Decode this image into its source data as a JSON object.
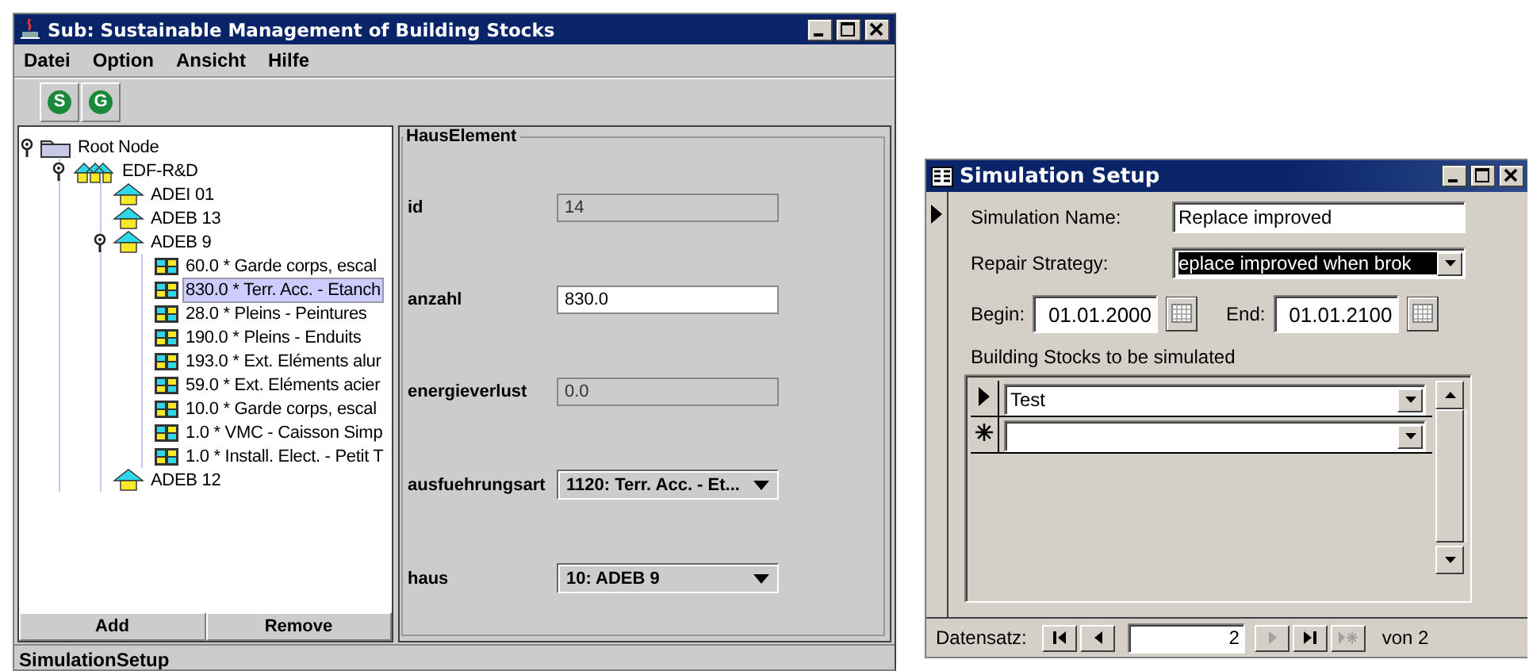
{
  "main_window": {
    "title": "Sub: Sustainable Management of Building Stocks",
    "menu": [
      "Datei",
      "Option",
      "Ansicht",
      "Hilfe"
    ],
    "toolbar": [
      {
        "label": "S"
      },
      {
        "label": "G"
      }
    ],
    "tree": [
      {
        "label": "Root Node",
        "kind": "folder",
        "expanded": true,
        "selected": false,
        "children": [
          {
            "label": "EDF-R&D",
            "kind": "group",
            "expanded": true,
            "selected": false,
            "children": [
              {
                "label": "ADEI 01",
                "kind": "house",
                "selected": false
              },
              {
                "label": "ADEB 13",
                "kind": "house",
                "selected": false
              },
              {
                "label": "ADEB 9",
                "kind": "house",
                "expanded": true,
                "selected": false,
                "children": [
                  {
                    "label": "60.0 * Garde corps, escal",
                    "kind": "element",
                    "selected": false
                  },
                  {
                    "label": "830.0 * Terr. Acc. - Etanch",
                    "kind": "element",
                    "selected": true
                  },
                  {
                    "label": "28.0 * Pleins - Peintures",
                    "kind": "element",
                    "selected": false
                  },
                  {
                    "label": "190.0 * Pleins - Enduits",
                    "kind": "element",
                    "selected": false
                  },
                  {
                    "label": "193.0 * Ext. Eléments alur",
                    "kind": "element",
                    "selected": false
                  },
                  {
                    "label": "59.0 * Ext. Eléments acier",
                    "kind": "element",
                    "selected": false
                  },
                  {
                    "label": "10.0 * Garde corps, escal",
                    "kind": "element",
                    "selected": false
                  },
                  {
                    "label": "1.0 * VMC - Caisson Simp",
                    "kind": "element",
                    "selected": false
                  },
                  {
                    "label": "1.0 * Install. Elect. - Petit T",
                    "kind": "element",
                    "selected": false
                  }
                ]
              },
              {
                "label": "ADEB 12",
                "kind": "house",
                "selected": false
              }
            ]
          }
        ]
      }
    ],
    "tree_buttons": [
      "Add",
      "Remove"
    ],
    "group_title": "HausElement",
    "fields": [
      {
        "label": "id",
        "kind": "text",
        "value": "14",
        "disabled": true
      },
      {
        "label": "anzahl",
        "kind": "text",
        "value": "830.0",
        "disabled": false
      },
      {
        "label": "energieverlust",
        "kind": "text",
        "value": "0.0",
        "disabled": true
      },
      {
        "label": "ausfuehrungsart",
        "kind": "combo",
        "value": "1120: Terr. Acc. - Et...",
        "disabled": false
      },
      {
        "label": "haus",
        "kind": "combo",
        "value": "10: ADEB 9",
        "disabled": false
      }
    ],
    "status_bar": "SimulationSetup"
  },
  "form_window": {
    "title": "Simulation Setup",
    "simulation_name": {
      "label": "Simulation Name:",
      "value": "Replace improved"
    },
    "repair_strategy": {
      "label": "Repair Strategy:",
      "value": "eplace improved when brok",
      "focused": true
    },
    "begin": {
      "label": "Begin:",
      "value": "01.01.2000"
    },
    "end": {
      "label": "End:",
      "value": "01.01.2100"
    },
    "subform": {
      "title": "Building Stocks to be simulated",
      "rows": [
        {
          "kind": "current",
          "value": "Test"
        },
        {
          "kind": "new"
        }
      ]
    },
    "navigation": {
      "label": "Datensatz:",
      "buttons": [
        {
          "kind": "first",
          "disabled": false
        },
        {
          "kind": "previous",
          "disabled": false
        }
      ],
      "record": "2",
      "buttons_after": [
        {
          "kind": "next",
          "disabled": true
        },
        {
          "kind": "last",
          "disabled": false
        },
        {
          "kind": "new",
          "disabled": true
        }
      ],
      "total": "von 2"
    }
  }
}
